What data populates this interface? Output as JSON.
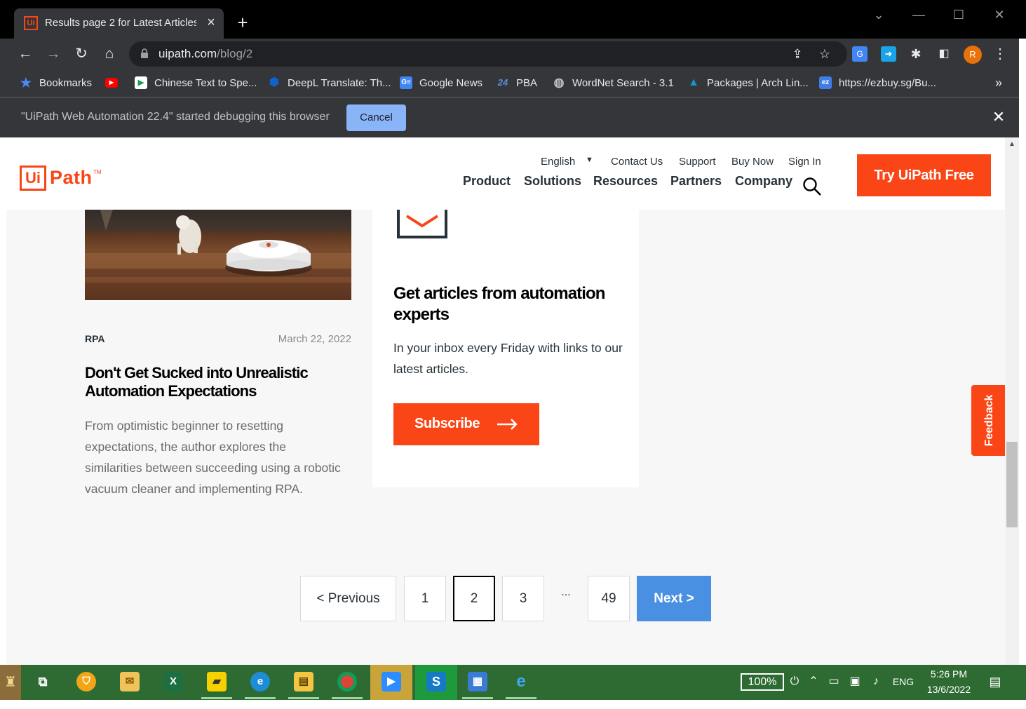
{
  "browser": {
    "tab_title": "Results page 2 for Latest Articles",
    "tab_favicon": "Ui",
    "url_host": "uipath.com",
    "url_path": "/blog/2",
    "bookmarks": [
      {
        "label": "Bookmarks",
        "icon": "star-icon",
        "color": "#4c8bf5",
        "glyph": "★"
      },
      {
        "label": "",
        "icon": "youtube-icon",
        "color": "#ff0000",
        "glyph": "▶"
      },
      {
        "label": "Chinese Text to Spe...",
        "icon": "play-icon",
        "color": "#1f9d55",
        "glyph": "▶"
      },
      {
        "label": "DeepL Translate: Th...",
        "icon": "deepl-icon",
        "color": "#0f2b46",
        "glyph": "⬢"
      },
      {
        "label": "Google News",
        "icon": "google-news-icon",
        "color": "#4285f4",
        "glyph": "G"
      },
      {
        "label": "PBA",
        "icon": "pba-icon",
        "color": "#3b6fb6",
        "glyph": "24"
      },
      {
        "label": "WordNet Search - 3.1",
        "icon": "globe-icon",
        "color": "#9aa0a6",
        "glyph": "◍"
      },
      {
        "label": "Packages | Arch Lin...",
        "icon": "arch-icon",
        "color": "#1793d1",
        "glyph": "▲"
      },
      {
        "label": "https://ezbuy.sg/Bu...",
        "icon": "ezbuy-icon",
        "color": "#3f7de8",
        "glyph": "ez"
      }
    ],
    "bookmarks_more": "»",
    "infobar_text": "\"UiPath Web Automation 22.4\" started debugging this browser",
    "infobar_cancel": "Cancel"
  },
  "site": {
    "logo_box": "Ui",
    "logo_text": "Path",
    "logo_tm": "TM",
    "util_links": {
      "language": "English",
      "contact": "Contact Us",
      "support": "Support",
      "buy": "Buy Now",
      "signin": "Sign In"
    },
    "nav": {
      "product": "Product",
      "solutions": "Solutions",
      "resources": "Resources",
      "partners": "Partners",
      "company": "Company"
    },
    "cta": "Try UiPath Free",
    "accent": "#fa4616"
  },
  "article": {
    "category": "RPA",
    "date": "March 22, 2022",
    "title": "Don't Get Sucked into Unrealistic Automation Expectations",
    "excerpt": "From optimistic beginner to resetting expectations, the author explores the similarities between succeeding using a robotic vacuum cleaner and implementing RPA."
  },
  "newsletter": {
    "title": "Get articles from automation experts",
    "description": "In your inbox every Friday with links to our latest articles.",
    "button": "Subscribe"
  },
  "feedback": "Feedback",
  "pagination": {
    "previous": "<  Previous",
    "pages": [
      "1",
      "2",
      "3"
    ],
    "current": "2",
    "ellipsis": "...",
    "last": "49",
    "next": "Next  >"
  },
  "taskbar": {
    "battery": "100%",
    "language": "ENG",
    "time": "5:26 PM",
    "date": "13/6/2022"
  }
}
